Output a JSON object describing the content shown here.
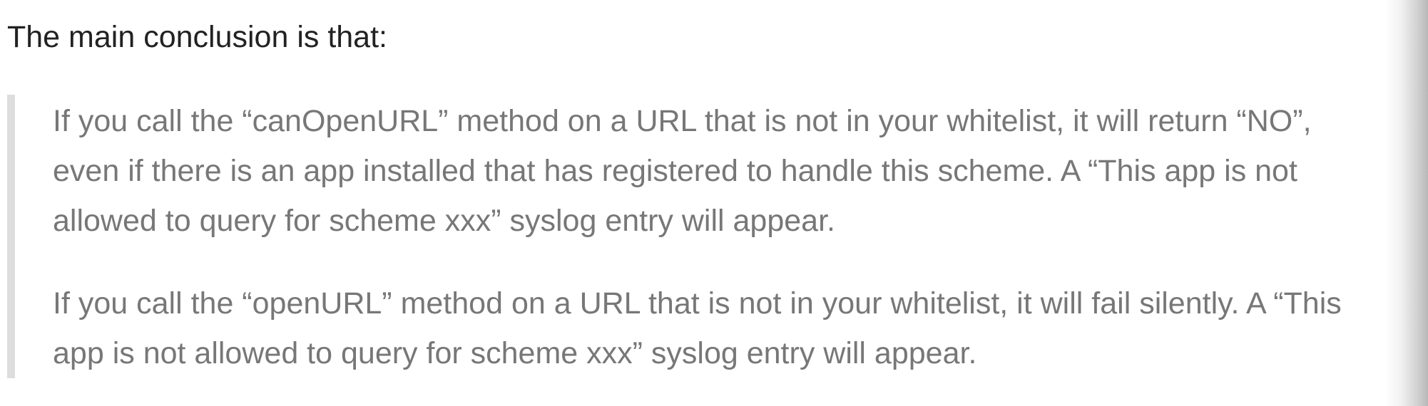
{
  "intro": "The main conclusion is that:",
  "quote": {
    "p1": {
      "line1": "If you call the “canOpenURL” method on a URL that is not in your whitelist, it will return “NO”,",
      "line2": "even if there is an app installed that has registered to handle this scheme. A “This app is not",
      "line3": "allowed to query for scheme xxx” syslog entry will appear."
    },
    "p2": {
      "line1": "If you call the “openURL” method on a URL that is not in your whitelist, it will fail silently. A “This",
      "line2": "app is not allowed to query for scheme xxx” syslog entry will appear."
    }
  }
}
